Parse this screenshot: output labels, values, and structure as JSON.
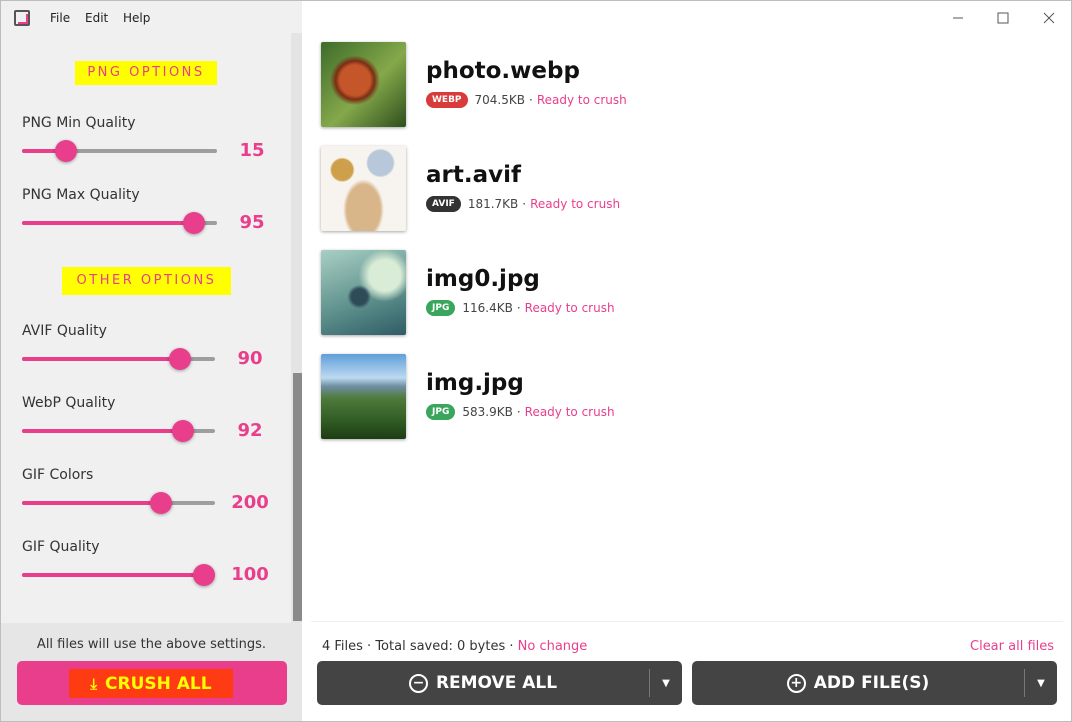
{
  "menu": {
    "file": "File",
    "edit": "Edit",
    "help": "Help"
  },
  "sidebar": {
    "png_section": "PNG OPTIONS",
    "other_section": "OTHER OPTIONS",
    "options": [
      {
        "label": "PNG Min Quality",
        "value": "15",
        "level": 0.19
      },
      {
        "label": "PNG Max Quality",
        "value": "95",
        "level": 0.93
      },
      {
        "label": "AVIF Quality",
        "value": "90",
        "level": 0.86
      },
      {
        "label": "WebP Quality",
        "value": "92",
        "level": 0.88
      },
      {
        "label": "GIF Colors",
        "value": "200",
        "level": 0.75
      },
      {
        "label": "GIF Quality",
        "value": "100",
        "level": 1.0
      }
    ],
    "footer_note": "All files will use the above settings.",
    "crush_all": "CRUSH ALL"
  },
  "files": [
    {
      "name": "photo.webp",
      "badge": "WEBP",
      "badge_color": "#d93a3a",
      "size": "704.5KB",
      "sep": "·",
      "status": "Ready to crush"
    },
    {
      "name": "art.avif",
      "badge": "AVIF",
      "badge_color": "#333333",
      "size": "181.7KB",
      "sep": "·",
      "status": "Ready to crush"
    },
    {
      "name": "img0.jpg",
      "badge": "JPG",
      "badge_color": "#3aa55c",
      "size": "116.4KB",
      "sep": "·",
      "status": "Ready to crush"
    },
    {
      "name": "img.jpg",
      "badge": "JPG",
      "badge_color": "#3aa55c",
      "size": "583.9KB",
      "sep": "·",
      "status": "Ready to crush"
    }
  ],
  "summary": {
    "count": "4 Files · Total saved: 0 bytes ·",
    "change": "No change",
    "clear": "Clear all files"
  },
  "buttons": {
    "remove_all": "REMOVE ALL",
    "add_files": "ADD FILE(S)"
  },
  "colors": {
    "accent": "#e83e8c",
    "highlight": "#ffff00",
    "crush": "#ff3b14",
    "dark_button": "#444444"
  },
  "icons": {
    "minimize": "minimize-icon",
    "maximize": "maximize-icon",
    "close": "close-icon",
    "download": "download-icon",
    "remove": "minus-circle-icon",
    "add": "plus-circle-icon"
  }
}
